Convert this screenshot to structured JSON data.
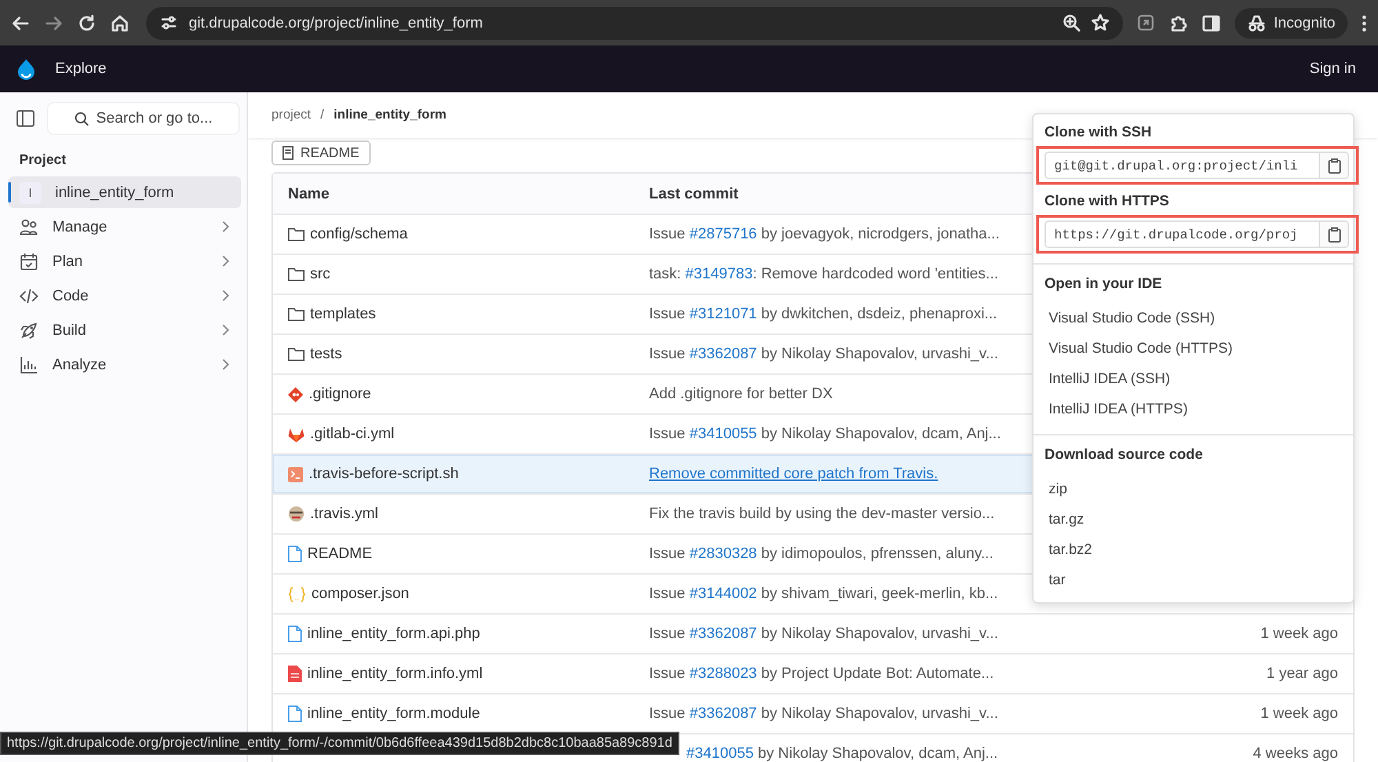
{
  "browser": {
    "url": "git.drupalcode.org/project/inline_entity_form",
    "profile": "Incognito"
  },
  "header": {
    "nav": "Explore",
    "sign_in": "Sign in"
  },
  "sidebar": {
    "search_placeholder": "Search or go to...",
    "section": "Project",
    "items": [
      {
        "kind": "project",
        "avatar": "I",
        "label": "inline_entity_form",
        "selected": true
      },
      {
        "kind": "menu",
        "label": "Manage",
        "selected": false
      },
      {
        "kind": "menu",
        "label": "Plan",
        "selected": false
      },
      {
        "kind": "menu",
        "label": "Code",
        "selected": false
      },
      {
        "kind": "menu",
        "label": "Build",
        "selected": false
      },
      {
        "kind": "menu",
        "label": "Analyze",
        "selected": false
      }
    ]
  },
  "breadcrumb": {
    "items": [
      "project",
      "inline_entity_form"
    ],
    "separator": "/"
  },
  "readme_button": "README",
  "table": {
    "columns": [
      "Name",
      "Last commit"
    ],
    "rows": [
      {
        "kind": "folder",
        "name": "config/schema",
        "hovered": false,
        "commit": [
          {
            "text": "Issue ",
            "kind": "text"
          },
          {
            "text": "#2875716",
            "kind": "link"
          },
          {
            "text": " by joevagyok, nicrodgers, jonatha...",
            "kind": "text"
          }
        ]
      },
      {
        "kind": "folder",
        "name": "src",
        "hovered": false,
        "commit": [
          {
            "text": "task: ",
            "kind": "text"
          },
          {
            "text": "#3149783",
            "kind": "link"
          },
          {
            "text": ": Remove hardcoded word 'entities...",
            "kind": "text"
          }
        ]
      },
      {
        "kind": "folder",
        "name": "templates",
        "hovered": false,
        "commit": [
          {
            "text": "Issue ",
            "kind": "text"
          },
          {
            "text": "#3121071",
            "kind": "link"
          },
          {
            "text": " by dwkitchen, dsdeiz, phenaproxi...",
            "kind": "text"
          }
        ]
      },
      {
        "kind": "folder",
        "name": "tests",
        "hovered": false,
        "commit": [
          {
            "text": "Issue ",
            "kind": "text"
          },
          {
            "text": "#3362087",
            "kind": "link"
          },
          {
            "text": " by Nikolay Shapovalov, urvashi_v...",
            "kind": "text"
          }
        ]
      },
      {
        "kind": "git",
        "name": ".gitignore",
        "hovered": false,
        "commit": [
          {
            "text": "Add .gitignore for better DX",
            "kind": "text"
          }
        ]
      },
      {
        "kind": "gitlab",
        "name": ".gitlab-ci.yml",
        "hovered": false,
        "commit": [
          {
            "text": "Issue ",
            "kind": "text"
          },
          {
            "text": "#3410055",
            "kind": "link"
          },
          {
            "text": " by Nikolay Shapovalov, dcam, Anj...",
            "kind": "text"
          }
        ]
      },
      {
        "kind": "shell",
        "name": ".travis-before-script.sh",
        "hovered": true,
        "commit": [
          {
            "text": "Remove committed core patch from Travis.",
            "kind": "link"
          }
        ]
      },
      {
        "kind": "travis",
        "name": ".travis.yml",
        "hovered": false,
        "commit": [
          {
            "text": "Fix the travis build by using the dev-master versio...",
            "kind": "text"
          }
        ]
      },
      {
        "kind": "file",
        "name": "README",
        "hovered": false,
        "commit": [
          {
            "text": "Issue ",
            "kind": "text"
          },
          {
            "text": "#2830328",
            "kind": "link"
          },
          {
            "text": " by idimopoulos, pfrenssen, aluny...",
            "kind": "text"
          }
        ]
      },
      {
        "kind": "json",
        "name": "composer.json",
        "hovered": false,
        "commit": [
          {
            "text": "Issue ",
            "kind": "text"
          },
          {
            "text": "#3144002",
            "kind": "link"
          },
          {
            "text": " by shivam_tiwari, geek-merlin, kb...",
            "kind": "text"
          }
        ]
      },
      {
        "kind": "file",
        "name": "inline_entity_form.api.php",
        "hovered": false,
        "time": "1 week ago",
        "commit": [
          {
            "text": "Issue ",
            "kind": "text"
          },
          {
            "text": "#3362087",
            "kind": "link"
          },
          {
            "text": " by Nikolay Shapovalov, urvashi_v...",
            "kind": "text"
          }
        ]
      },
      {
        "kind": "yaml",
        "name": "inline_entity_form.info.yml",
        "hovered": false,
        "time": "1 year ago",
        "commit": [
          {
            "text": "Issue ",
            "kind": "text"
          },
          {
            "text": "#3288023",
            "kind": "link"
          },
          {
            "text": " by Project Update Bot: Automate...",
            "kind": "text"
          }
        ]
      },
      {
        "kind": "file",
        "name": "inline_entity_form.module",
        "hovered": false,
        "time": "1 week ago",
        "commit": [
          {
            "text": "Issue ",
            "kind": "text"
          },
          {
            "text": "#3362087",
            "kind": "link"
          },
          {
            "text": " by Nikolay Shapovalov, urvashi_v...",
            "kind": "text"
          }
        ]
      },
      {
        "hovered": false,
        "time": "4 weeks ago",
        "commit": [
          {
            "text": "#3410055",
            "kind": "link"
          },
          {
            "text": " by Nikolay Shapovalov, dcam, Anj...",
            "kind": "text"
          }
        ]
      }
    ]
  },
  "clone_menu": {
    "clone": [
      {
        "title": "Clone with SSH",
        "value": "git@git.drupal.org:project/inli",
        "highlighted": true
      },
      {
        "title": "Clone with HTTPS",
        "value": "https://git.drupalcode.org/proj",
        "highlighted": true
      }
    ],
    "sections": [
      {
        "title": "Open in your IDE",
        "items": [
          "Visual Studio Code (SSH)",
          "Visual Studio Code (HTTPS)",
          "IntelliJ IDEA (SSH)",
          "IntelliJ IDEA (HTTPS)"
        ]
      },
      {
        "title": "Download source code",
        "items": [
          "zip",
          "tar.gz",
          "tar.bz2",
          "tar"
        ]
      }
    ]
  },
  "status_url": "https://git.drupalcode.org/project/inline_entity_form/-/commit/0b6d6ffeea439d15d8b2dbc8c10baa85a89c891d"
}
